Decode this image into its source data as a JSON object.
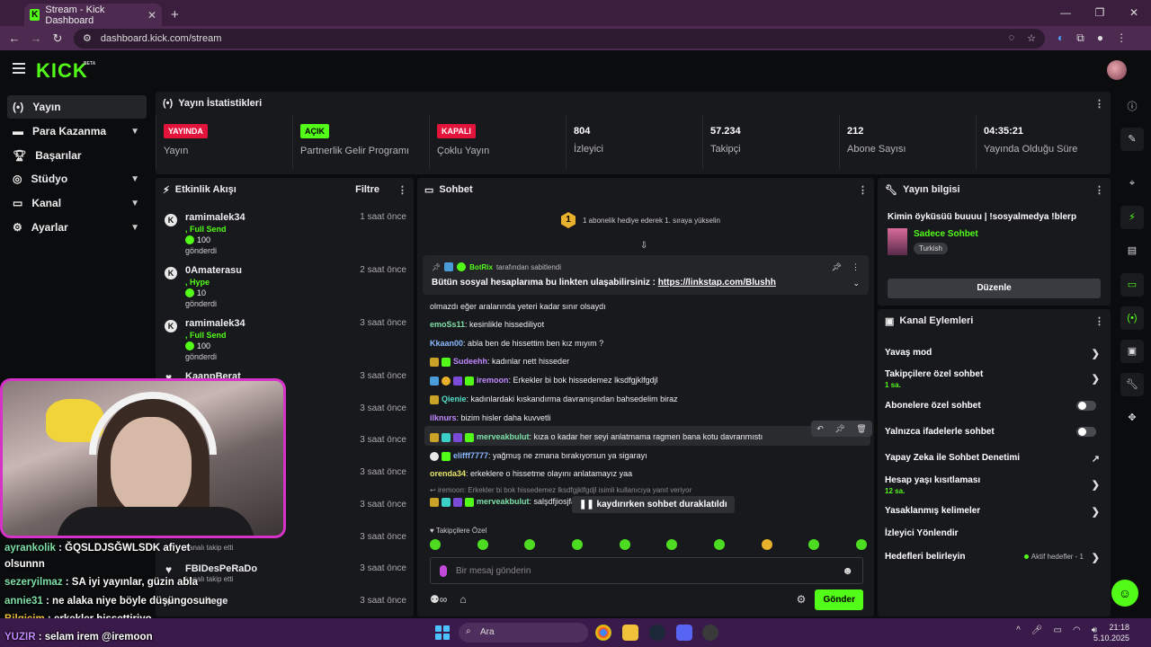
{
  "browser": {
    "tab_title": "Stream - Kick Dashboard",
    "url": "dashboard.kick.com/stream"
  },
  "header": {
    "logo": "KICK",
    "beta": "BETA"
  },
  "sidebar": {
    "items": [
      {
        "label": "Yayın",
        "icon": "broadcast-icon",
        "active": true
      },
      {
        "label": "Para Kazanma",
        "icon": "money-icon",
        "expandable": true
      },
      {
        "label": "Başarılar",
        "icon": "trophy-icon"
      },
      {
        "label": "Stüdyo",
        "icon": "studio-icon",
        "expandable": true
      },
      {
        "label": "Kanal",
        "icon": "channel-icon",
        "expandable": true
      },
      {
        "label": "Ayarlar",
        "icon": "gear-icon",
        "expandable": true
      }
    ]
  },
  "stats": {
    "title": "Yayın İstatistikleri",
    "cards": [
      {
        "badge": "YAYINDA",
        "label": "Yayın"
      },
      {
        "badge": "AÇIK",
        "label": "Partnerlik Gelir Programı"
      },
      {
        "badge": "KAPALI",
        "label": "Çoklu Yayın"
      },
      {
        "value": "804",
        "label": "İzleyici"
      },
      {
        "value": "57.234",
        "label": "Takipçi"
      },
      {
        "value": "212",
        "label": "Abone Sayısı"
      },
      {
        "value": "04:35:21",
        "label": "Yayında Olduğu Süre"
      }
    ]
  },
  "activity": {
    "title": "Etkinlik Akışı",
    "filter": "Filtre",
    "gifts": [
      {
        "name": "ramimalek34",
        "time": "1 saat önce",
        "gift": ", Full Send",
        "amount": "100",
        "sent": "gönderdi"
      },
      {
        "name": "0Amaterasu",
        "time": "2 saat önce",
        "gift": ", Hype",
        "amount": "10",
        "sent": "gönderdi"
      },
      {
        "name": "ramimalek34",
        "time": "3 saat önce",
        "gift": ", Full Send",
        "amount": "100",
        "sent": "gönderdi"
      }
    ],
    "follows": [
      {
        "name": "KaanpBerat",
        "time": "3 saat önce"
      },
      {
        "time": "3 saat önce"
      },
      {
        "time": "3 saat önce"
      },
      {
        "time": "3 saat önce"
      },
      {
        "time": "3 saat önce"
      },
      {
        "time": "3 saat önce",
        "sub": "kanalı takip etti"
      },
      {
        "name": "FBIDesPeRaDo",
        "time": "3 saat önce",
        "sub": "kanalı takip etti"
      },
      {
        "name": "uitege",
        "time": "3 saat önce"
      }
    ]
  },
  "chat": {
    "title": "Sohbet",
    "goal_number": "1",
    "goal_text": "1 abonelik hediye ederek 1. sıraya yükselin",
    "pinned_by_name": "BotRix",
    "pinned_by_suffix": "tarafından sabitlendi",
    "pinned_text": "Bütün sosyal hesaplarıma bu linkten ulaşabilirsiniz : ",
    "pinned_link": "https://linkstap.com/Blushh",
    "messages": [
      {
        "user": "",
        "text": "olmazdı eğer aralarında yeteri kadar sınır olsaydı",
        "color": "#eeeeee"
      },
      {
        "user": "emoSs11",
        "text": ": kesinlikle hissediliyot",
        "color": "#7ee0a8"
      },
      {
        "user": "Kkaan00",
        "text": ": abla ben de hissettim ben kız mıyım ?",
        "color": "#8ab8ff"
      },
      {
        "user": "Sudeehh",
        "text": ": kadınlar nett hisseder",
        "color": "#c089ff"
      },
      {
        "user": "iremoon",
        "text": ": Erkekler bi bok hissedemez lksdfgjklfgdjl",
        "color": "#c089ff"
      },
      {
        "user": "Qienie",
        "text": ": kadınlardaki kıskandırma davranışından bahsedelim biraz",
        "color": "#56e0c8"
      },
      {
        "user": "ilknurs",
        "text": ": bizim hisler daha kuvvetli",
        "color": "#c089ff"
      },
      {
        "user": "merveakbulut",
        "text": ": kıza o kadar her seyi anlatmama ragmen bana kotu davranmıstı",
        "color": "#7ee0a8"
      },
      {
        "user": "elifff7777",
        "text": ": yağmuş ne zmana bırakıyorsun ya sigarayı",
        "color": "#8ab8ff"
      },
      {
        "user": "orenda34",
        "text": ": erkeklere o hissetme olayını anlatamayız yaa",
        "color": "#e6e66a"
      },
      {
        "user": "iremoon: Erkekler bi bok hissedemez lksdfgjklfgdjl isimli kullanıcıya yanıt veriyor",
        "text": "",
        "color": "#8a8a8a"
      },
      {
        "user": "merveakbulut",
        "text": ": salşdfjiosjfas",
        "color": "#7ee0a8"
      }
    ],
    "paused": "kaydırırken sohbet duraklatıldı",
    "followers_only": "Takipçilere Özel",
    "input_placeholder": "Bir mesaj gönderin",
    "send": "Gönder"
  },
  "stream_info": {
    "title": "Yayın bilgisi",
    "stream_title": "Kimin öyküsüü buuuu | !sosyalmedya !blerp",
    "category": "Sadece Sohbet",
    "language": "Turkish",
    "edit": "Düzenle"
  },
  "channel_actions": {
    "title": "Kanal Eylemleri",
    "slow_mode": "Yavaş mod",
    "followers_chat": "Takipçilere özel sohbet",
    "followers_chat_sub": "1 sa.",
    "subs_chat": "Abonelere özel sohbet",
    "emotes_chat": "Yalnızca ifadelerle sohbet",
    "ai_mod": "Yapay Zeka ile Sohbet Denetimi",
    "age_limit": "Hesap yaşı kısıtlaması",
    "age_limit_sub": "12 sa.",
    "banned_words": "Yasaklanmış kelimeler",
    "redirect": "İzleyici Yönlendir",
    "goals": "Hedefleri belirleyin",
    "goals_status": "Aktif hedefler - 1"
  },
  "overlay_chat": [
    {
      "user": "ayrankolik",
      "text": " : ĞQSLDJSĞWLSDK afiyet",
      "color": "#7ee0a8"
    },
    {
      "user": "",
      "text": "olsunnn",
      "color": "#ffffff"
    },
    {
      "user": "sezeryilmaz",
      "text": " : SA iyi yayınlar, güzin abla",
      "color": "#7ee0a8"
    },
    {
      "user": "annie31",
      "text": " : ne alaka niye böyle düşüngosun",
      "color": "#7ee0a8"
    },
    {
      "user": "Bilgicim",
      "text": " : erkekler hissettiriyo",
      "color": "#f0c23a"
    },
    {
      "user": "YUZIR",
      "text": " : selam irem @iremoon",
      "color": "#c089ff"
    }
  ],
  "taskbar": {
    "search": "Ara",
    "time": "21:18",
    "date": "5.10.2025"
  }
}
